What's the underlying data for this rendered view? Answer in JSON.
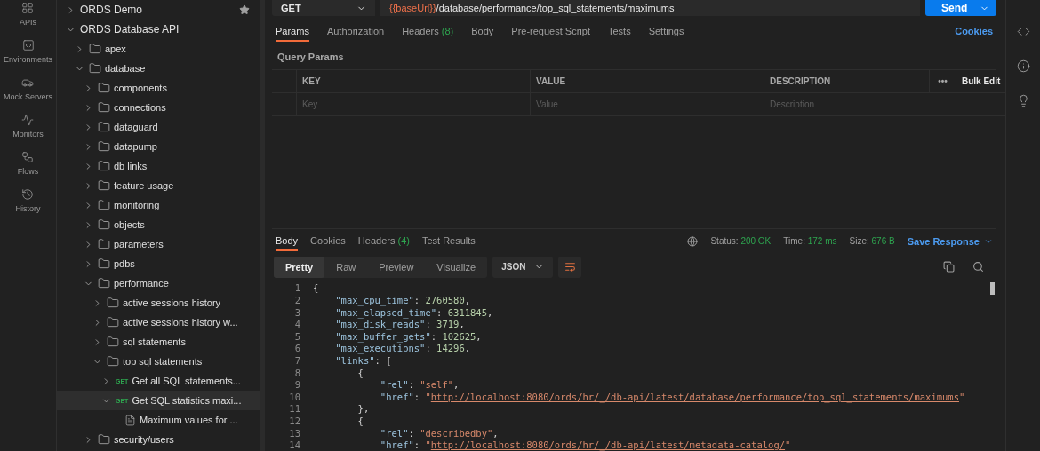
{
  "nav_rail": {
    "items": [
      {
        "kind": "apis",
        "label": "APIs"
      },
      {
        "kind": "environments",
        "label": "Environments"
      },
      {
        "kind": "mock",
        "label": "Mock Servers"
      },
      {
        "kind": "monitors",
        "label": "Monitors"
      },
      {
        "kind": "flows",
        "label": "Flows"
      },
      {
        "kind": "history",
        "label": "History"
      }
    ]
  },
  "sidebar": {
    "items": [
      {
        "kind": "collection",
        "label": "ORDS Demo",
        "expanded": false,
        "starred": true,
        "selected": false
      },
      {
        "kind": "collection",
        "label": "ORDS Database API",
        "expanded": true,
        "selected": false,
        "children": [
          {
            "kind": "folder",
            "label": "apex",
            "expanded": false,
            "selected": false
          },
          {
            "kind": "folder",
            "label": "database",
            "expanded": true,
            "selected": false,
            "children": [
              {
                "kind": "folder",
                "label": "components",
                "expanded": false,
                "selected": false
              },
              {
                "kind": "folder",
                "label": "connections",
                "expanded": false,
                "selected": false
              },
              {
                "kind": "folder",
                "label": "dataguard",
                "expanded": false,
                "selected": false
              },
              {
                "kind": "folder",
                "label": "datapump",
                "expanded": false,
                "selected": false
              },
              {
                "kind": "folder",
                "label": "db links",
                "expanded": false,
                "selected": false
              },
              {
                "kind": "folder",
                "label": "feature usage",
                "expanded": false,
                "selected": false
              },
              {
                "kind": "folder",
                "label": "monitoring",
                "expanded": false,
                "selected": false
              },
              {
                "kind": "folder",
                "label": "objects",
                "expanded": false,
                "selected": false
              },
              {
                "kind": "folder",
                "label": "parameters",
                "expanded": false,
                "selected": false
              },
              {
                "kind": "folder",
                "label": "pdbs",
                "expanded": false,
                "selected": false
              },
              {
                "kind": "folder",
                "label": "performance",
                "expanded": true,
                "selected": false,
                "children": [
                  {
                    "kind": "folder",
                    "label": "active sessions history",
                    "expanded": false,
                    "selected": false
                  },
                  {
                    "kind": "folder",
                    "label": "active sessions history w...",
                    "expanded": false,
                    "selected": false
                  },
                  {
                    "kind": "folder",
                    "label": "sql statements",
                    "expanded": false,
                    "selected": false
                  },
                  {
                    "kind": "folder",
                    "label": "top sql statements",
                    "expanded": true,
                    "selected": false,
                    "children": [
                      {
                        "kind": "request",
                        "method": "GET",
                        "label": "Get all SQL statements...",
                        "expanded": false,
                        "selected": false
                      },
                      {
                        "kind": "request",
                        "method": "GET",
                        "label": "Get SQL statistics maxi...",
                        "expanded": true,
                        "selected": true,
                        "children": [
                          {
                            "kind": "example",
                            "label": "Maximum values for ...",
                            "selected": false
                          }
                        ]
                      }
                    ]
                  }
                ]
              },
              {
                "kind": "folder",
                "label": "security/users",
                "expanded": false,
                "selected": false
              }
            ]
          }
        ]
      }
    ]
  },
  "request": {
    "method": "GET",
    "url": [
      {
        "kind": "variable",
        "text": "{{baseUrl}}"
      },
      {
        "kind": "path",
        "text": "/database/performance/top_sql_statements/maximums"
      }
    ],
    "send": "Send"
  },
  "request_tabs": [
    {
      "label": "Params",
      "selected": true
    },
    {
      "label": "Authorization",
      "selected": false
    },
    {
      "label": "Headers",
      "count": "(8)",
      "selected": false
    },
    {
      "label": "Body",
      "selected": false
    },
    {
      "label": "Pre-request Script",
      "selected": false
    },
    {
      "label": "Tests",
      "selected": false
    },
    {
      "label": "Settings",
      "selected": false
    }
  ],
  "cookies_link": "Cookies",
  "query_params": {
    "title": "Query Params",
    "columns": [
      "KEY",
      "VALUE",
      "DESCRIPTION"
    ],
    "more": "•••",
    "bulk_edit": "Bulk Edit",
    "placeholders": [
      "Key",
      "Value",
      "Description"
    ]
  },
  "response_tabs": [
    {
      "label": "Body",
      "selected": true
    },
    {
      "label": "Cookies",
      "selected": false
    },
    {
      "label": "Headers",
      "count": "(4)",
      "selected": false
    },
    {
      "label": "Test Results",
      "selected": false
    }
  ],
  "response_meta": [
    {
      "label": "Status:",
      "value": "200 OK"
    },
    {
      "label": "Time:",
      "value": "172 ms"
    },
    {
      "label": "Size:",
      "value": "676 B"
    }
  ],
  "save_response": "Save Response",
  "view_modes": [
    {
      "label": "Pretty",
      "selected": true
    },
    {
      "label": "Raw",
      "selected": false
    },
    {
      "label": "Preview",
      "selected": false
    },
    {
      "label": "Visualize",
      "selected": false
    }
  ],
  "format": "JSON",
  "code": [
    {
      "n": "1",
      "tokens": [
        {
          "kind": "punct",
          "text": "{"
        }
      ]
    },
    {
      "n": "2",
      "tokens": [
        {
          "kind": "key",
          "text": "    \"max_cpu_time\""
        },
        {
          "kind": "punct",
          "text": ": "
        },
        {
          "kind": "number",
          "text": "2760580"
        },
        {
          "kind": "punct",
          "text": ","
        }
      ]
    },
    {
      "n": "3",
      "tokens": [
        {
          "kind": "key",
          "text": "    \"max_elapsed_time\""
        },
        {
          "kind": "punct",
          "text": ": "
        },
        {
          "kind": "number",
          "text": "6311845"
        },
        {
          "kind": "punct",
          "text": ","
        }
      ]
    },
    {
      "n": "4",
      "tokens": [
        {
          "kind": "key",
          "text": "    \"max_disk_reads\""
        },
        {
          "kind": "punct",
          "text": ": "
        },
        {
          "kind": "number",
          "text": "3719"
        },
        {
          "kind": "punct",
          "text": ","
        }
      ]
    },
    {
      "n": "5",
      "tokens": [
        {
          "kind": "key",
          "text": "    \"max_buffer_gets\""
        },
        {
          "kind": "punct",
          "text": ": "
        },
        {
          "kind": "number",
          "text": "102625"
        },
        {
          "kind": "punct",
          "text": ","
        }
      ]
    },
    {
      "n": "6",
      "tokens": [
        {
          "kind": "key",
          "text": "    \"max_executions\""
        },
        {
          "kind": "punct",
          "text": ": "
        },
        {
          "kind": "number",
          "text": "14296"
        },
        {
          "kind": "punct",
          "text": ","
        }
      ]
    },
    {
      "n": "7",
      "tokens": [
        {
          "kind": "key",
          "text": "    \"links\""
        },
        {
          "kind": "punct",
          "text": ": ["
        }
      ]
    },
    {
      "n": "8",
      "tokens": [
        {
          "kind": "punct",
          "text": "        {"
        }
      ]
    },
    {
      "n": "9",
      "tokens": [
        {
          "kind": "key",
          "text": "            \"rel\""
        },
        {
          "kind": "punct",
          "text": ": "
        },
        {
          "kind": "string",
          "text": "\"self\""
        },
        {
          "kind": "punct",
          "text": ","
        }
      ]
    },
    {
      "n": "10",
      "tokens": [
        {
          "kind": "key",
          "text": "            \"href\""
        },
        {
          "kind": "punct",
          "text": ": "
        },
        {
          "kind": "string",
          "text": "\""
        },
        {
          "kind": "link",
          "text": "http://localhost:8080/ords/hr/_/db-api/latest/database/performance/top_sql_statements/maximums"
        },
        {
          "kind": "string",
          "text": "\""
        }
      ]
    },
    {
      "n": "11",
      "tokens": [
        {
          "kind": "punct",
          "text": "        },"
        }
      ]
    },
    {
      "n": "12",
      "tokens": [
        {
          "kind": "punct",
          "text": "        {"
        }
      ]
    },
    {
      "n": "13",
      "tokens": [
        {
          "kind": "key",
          "text": "            \"rel\""
        },
        {
          "kind": "punct",
          "text": ": "
        },
        {
          "kind": "string",
          "text": "\"describedby\""
        },
        {
          "kind": "punct",
          "text": ","
        }
      ]
    },
    {
      "n": "14",
      "tokens": [
        {
          "kind": "key",
          "text": "            \"href\""
        },
        {
          "kind": "punct",
          "text": ": "
        },
        {
          "kind": "string",
          "text": "\""
        },
        {
          "kind": "link",
          "text": "http://localhost:8080/ords/hr/_/db-api/latest/metadata-catalog/"
        },
        {
          "kind": "string",
          "text": "\""
        }
      ]
    }
  ],
  "right_rail": [
    {
      "kind": "code"
    },
    {
      "kind": "info"
    },
    {
      "kind": "bulb"
    }
  ]
}
